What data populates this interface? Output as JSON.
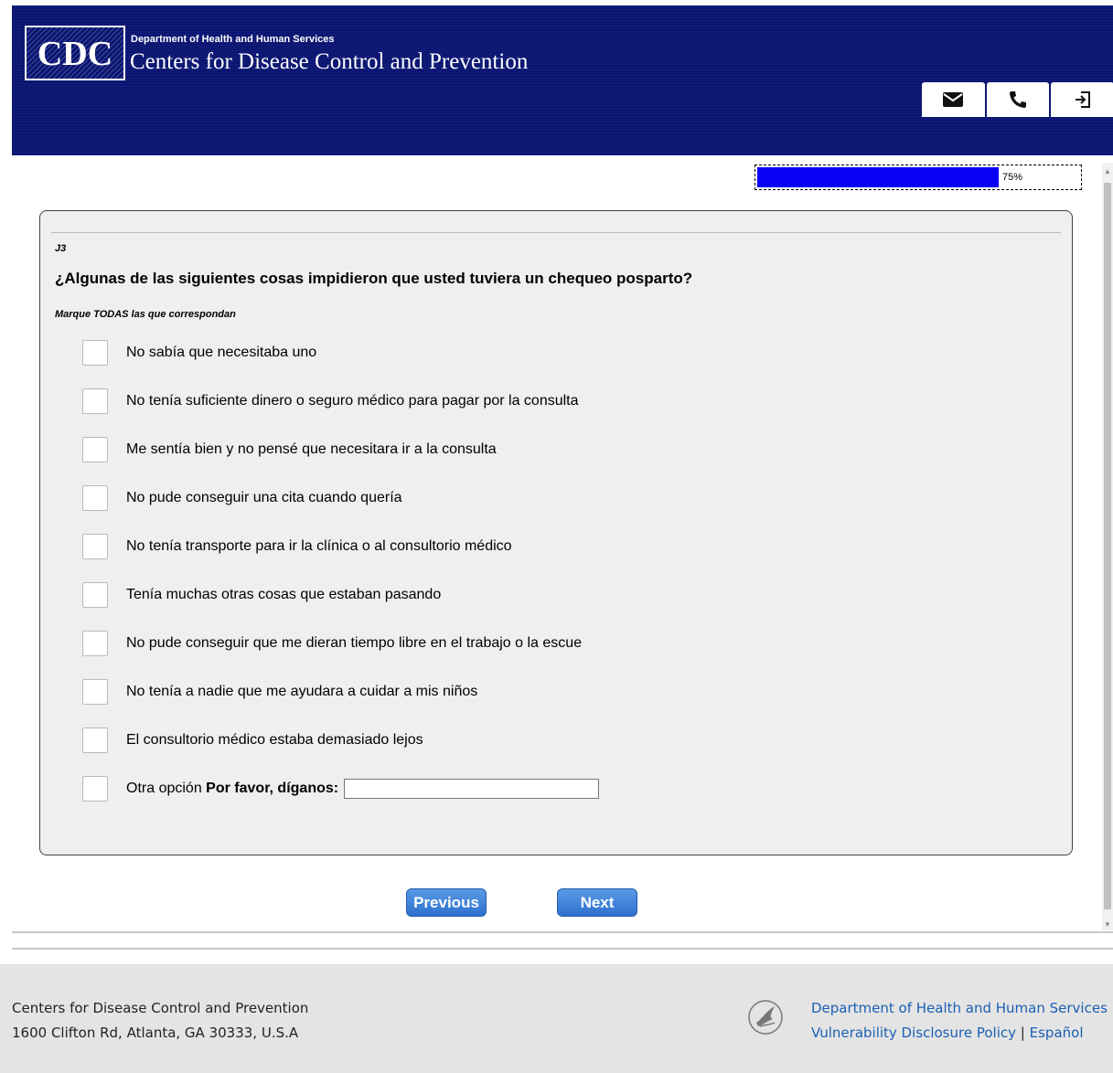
{
  "header": {
    "logo_text": "CDC",
    "department": "Department of Health and Human Services",
    "agency": "Centers for Disease Control and Prevention",
    "buttons": [
      {
        "icon": "envelope-icon"
      },
      {
        "icon": "phone-icon"
      },
      {
        "icon": "exit-icon"
      }
    ]
  },
  "progress": {
    "percent": 75,
    "label": "75%"
  },
  "question": {
    "id": "J3",
    "text": "¿Algunas de las siguientes cosas impidieron que usted tuviera un chequeo posparto?",
    "instruction": "Marque TODAS las que correspondan",
    "options": [
      {
        "label": "No sabía que necesitaba uno",
        "checked": false
      },
      {
        "label": "No tenía suficiente dinero o seguro médico para pagar por la consulta",
        "checked": false
      },
      {
        "label": "Me sentía bien y no pensé que necesitara ir a la consulta",
        "checked": false
      },
      {
        "label": "No pude conseguir una cita cuando quería",
        "checked": false
      },
      {
        "label": "No tenía transporte para ir la clínica o al consultorio médico",
        "checked": false
      },
      {
        "label": "Tenía muchas otras cosas que estaban pasando",
        "checked": false
      },
      {
        "label": "No pude conseguir que me dieran tiempo libre en el trabajo o la escue",
        "checked": false
      },
      {
        "label": "No tenía a nadie que me ayudara a cuidar a mis niños",
        "checked": false
      },
      {
        "label": "El consultorio médico estaba demasiado lejos",
        "checked": false
      }
    ],
    "other": {
      "label": "Otra opción",
      "prompt": "Por favor, díganos:",
      "value": "",
      "checked": false
    }
  },
  "nav": {
    "previous_label": "Previous",
    "next_label": "Next"
  },
  "footer": {
    "org_name": "Centers for Disease Control and Prevention",
    "address": "1600 Clifton Rd, Atlanta, GA 30333, U.S.A",
    "hhs_link": "Department of Health and Human Services",
    "vdp_link": "Vulnerability Disclosure Policy",
    "separator": "|",
    "spanish_link": "Español"
  },
  "colors": {
    "header_bg": "#0b1673",
    "progress_fill": "#0a00f5",
    "button_blue": "#2e71cf",
    "link_blue": "#1a5fb4",
    "panel_bg": "#efefef"
  }
}
